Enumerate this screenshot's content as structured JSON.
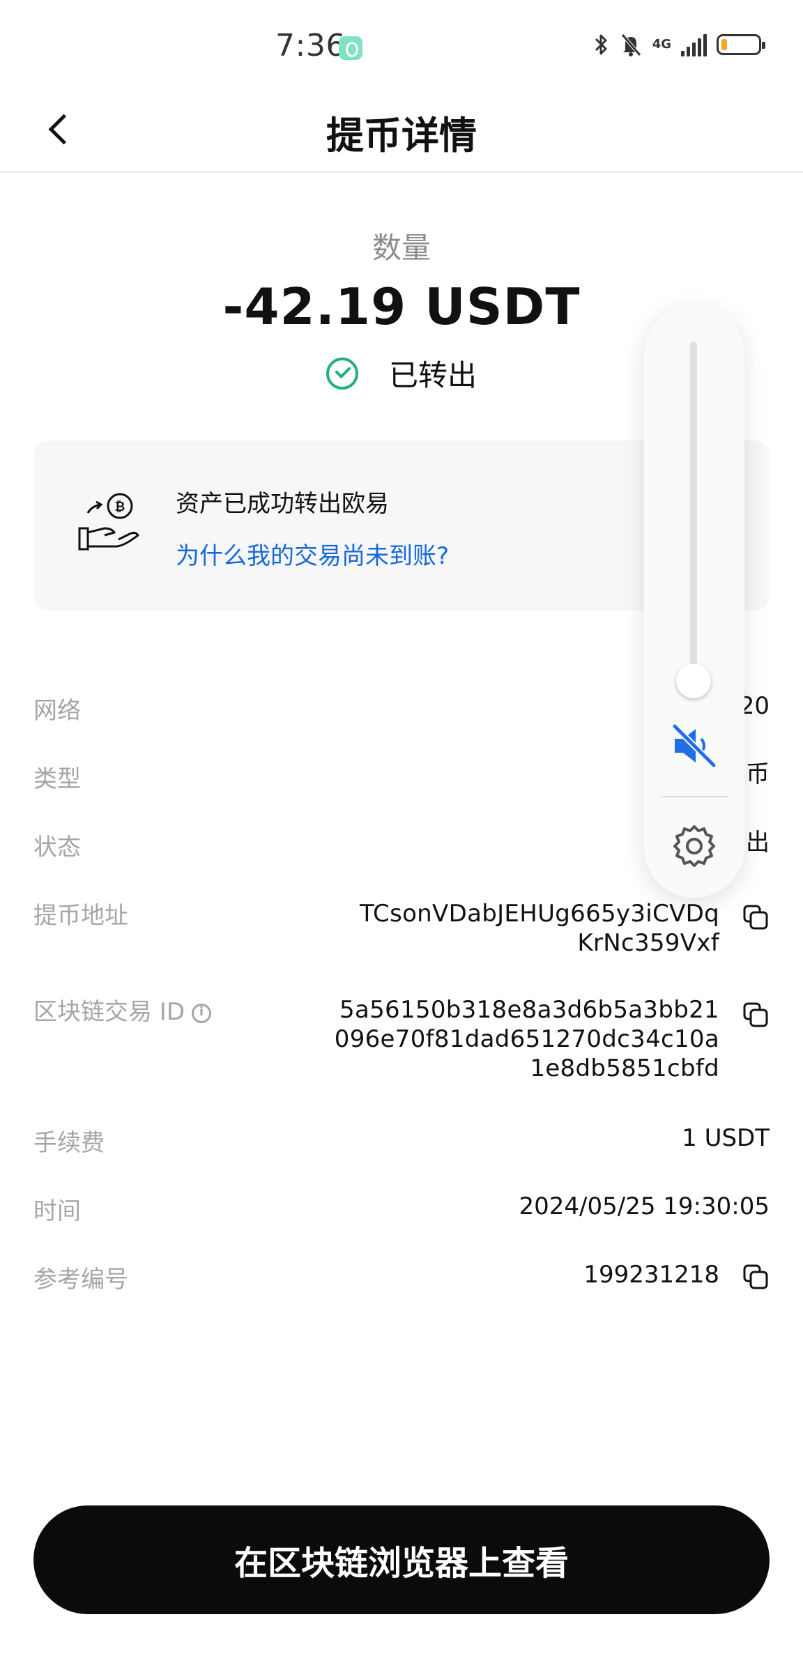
{
  "status_bar": {
    "time": "7:36",
    "network": "4G",
    "battery_level": 0.15,
    "battery_color": "#f5a623"
  },
  "header": {
    "title": "提币详情"
  },
  "amount": {
    "label": "数量",
    "value": "-42.19 USDT",
    "status": "已转出",
    "status_color": "#21b07a"
  },
  "notice_card": {
    "title": "资产已成功转出欧易",
    "link": "为什么我的交易尚未到账?",
    "link_color": "#1668dc",
    "icon": "hand-coin-icon"
  },
  "details": {
    "network": {
      "label": "网络",
      "value": "20"
    },
    "type": {
      "label": "类型",
      "value": "币"
    },
    "state": {
      "label": "状态",
      "value": "出"
    },
    "address": {
      "label": "提币地址",
      "value_line1": "TCsonVDabJEHUg665y3iCVDq",
      "value_line2": "KrNc359Vxf"
    },
    "txid": {
      "label": "区块链交易 ID",
      "value_line1": "5a56150b318e8a3d6b5a3bb21",
      "value_line2": "096e70f81dad651270dc34c10a",
      "value_line3": "1e8db5851cbfd"
    },
    "fee": {
      "label": "手续费",
      "value": "1 USDT"
    },
    "time": {
      "label": "时间",
      "value": "2024/05/25 19:30:05"
    },
    "reference": {
      "label": "参考编号",
      "value": "199231218"
    }
  },
  "volume_overlay": {
    "level": 0.0,
    "muted": true,
    "accent": "#1f6fe5",
    "icons": [
      "speaker-muted-icon",
      "settings-gear-icon"
    ]
  },
  "footer": {
    "button_label": "在区块链浏览器上查看"
  }
}
